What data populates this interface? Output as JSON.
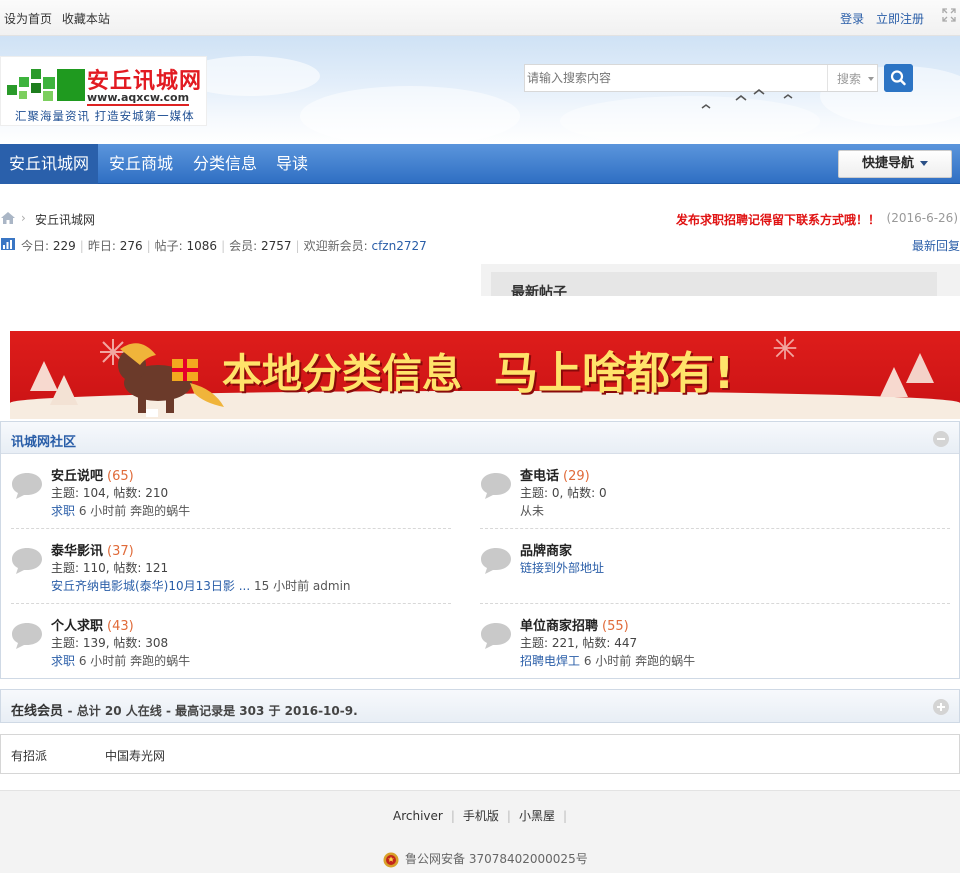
{
  "topbar": {
    "set_home": "设为首页",
    "bookmark": "收藏本站",
    "login": "登录",
    "register": "立即注册"
  },
  "header": {
    "logo_title": "安丘讯城网",
    "logo_url": "www.aqxcw.com",
    "logo_slogan": "汇聚海量资讯  打造安城第一媒体",
    "search_placeholder": "请输入搜索内容",
    "search_type": "搜索"
  },
  "nav": {
    "items": [
      "安丘讯城网",
      "安丘商城",
      "分类信息",
      "导读"
    ],
    "quick_nav": "快捷导航"
  },
  "breadcrumb": {
    "current": "安丘讯城网",
    "notice": "发布求职招聘记得留下联系方式哦！！",
    "date": "(2016-6-26)"
  },
  "stats": {
    "today_label": "今日:",
    "today": "229",
    "yesterday_label": "昨日:",
    "yesterday": "276",
    "posts_label": "帖子:",
    "posts": "1086",
    "members_label": "会员:",
    "members": "2757",
    "welcome_label": "欢迎新会员:",
    "new_member": "cfzn2727",
    "latest_reply": "最新回复"
  },
  "new_posts": {
    "title": "最新帖子"
  },
  "banner": {
    "text1": "本地分类信息",
    "text2": "马上啥都有!"
  },
  "community": {
    "title": "讯城网社区",
    "boards": [
      {
        "name": "安丘说吧",
        "count": "(65)",
        "meta": "主题: 104, 帖数: 210",
        "last_link": "求职",
        "last_time": "6 小时前",
        "last_user": "奔跑的蜗牛"
      },
      {
        "name": "查电话",
        "count": "(29)",
        "meta": "主题: 0, 帖数: 0",
        "last_link": "",
        "last_time": "从未",
        "last_user": ""
      },
      {
        "name": "泰华影讯",
        "count": "(37)",
        "meta": "主题: 110, 帖数: 121",
        "last_link": "安丘齐纳电影城(泰华)10月13日影 ...",
        "last_time": "15 小时前",
        "last_user": "admin"
      },
      {
        "name": "品牌商家",
        "count": "",
        "meta": "",
        "last_link": "链接到外部地址",
        "last_time": "",
        "last_user": ""
      },
      {
        "name": "个人求职",
        "count": "(43)",
        "meta": "主题: 139, 帖数: 308",
        "last_link": "求职",
        "last_time": "6 小时前",
        "last_user": "奔跑的蜗牛"
      },
      {
        "name": "单位商家招聘",
        "count": "(55)",
        "meta": "主题: 221, 帖数: 447",
        "last_link": "招聘电焊工",
        "last_time": "6 小时前",
        "last_user": "奔跑的蜗牛"
      }
    ]
  },
  "online": {
    "title": "在线会员",
    "summary": "- 总计 20 人在线 - 最高记录是 303 于 2016-10-9."
  },
  "links": [
    "有招派",
    "中国寿光网"
  ],
  "footer": {
    "links": [
      "Archiver",
      "手机版",
      "小黑屋"
    ],
    "police": "鲁公网安备 37078402000025号"
  },
  "colors": {
    "nav_blue": "#3a7bcf",
    "link_blue": "#2a5ea8",
    "notice_red": "#e01212",
    "count_orange": "#e06b3a"
  }
}
